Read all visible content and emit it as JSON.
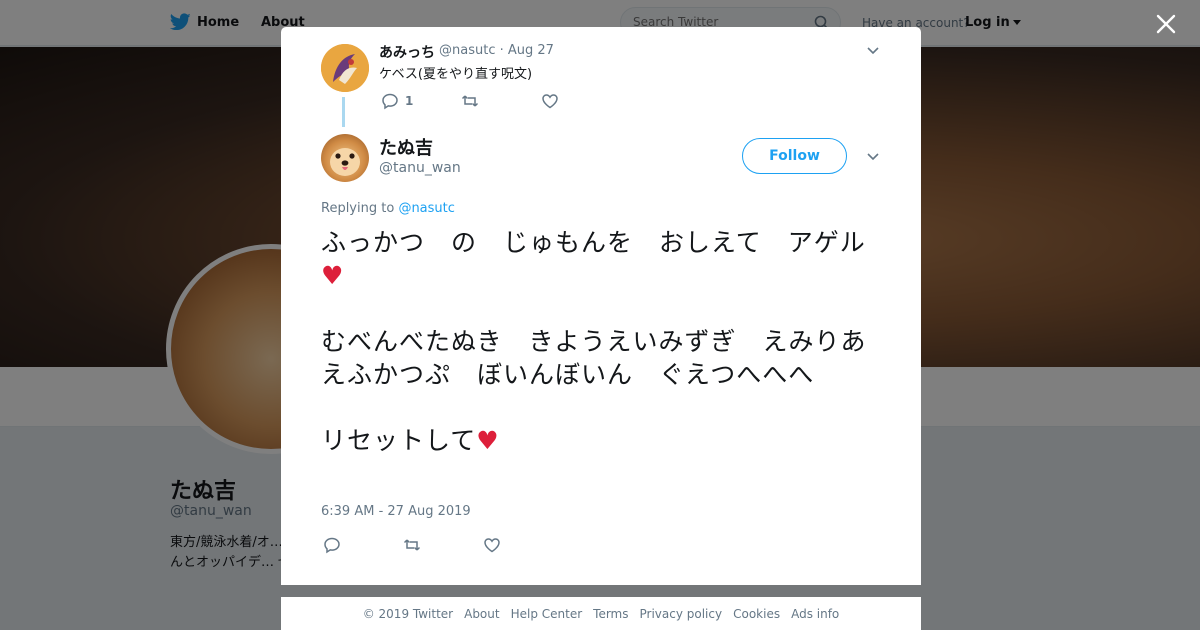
{
  "background": {
    "nav": {
      "home": "Home",
      "about": "About"
    },
    "search": {
      "placeholder": "Search Twitter"
    },
    "account_prompt": "Have an account?",
    "login": "Log in",
    "profile": {
      "name": "たぬ吉",
      "handle": "@tanu_wan",
      "bio": "東方/競泳水着/オ… ー何でもたまらね… ゃんとオッパイデ… ぜ。"
    }
  },
  "modal": {
    "parent_tweet": {
      "name": "あみっち",
      "handle": "@nasutc",
      "date": "Aug 27",
      "text": "ケベス(夏をやり直す呪文)",
      "reply_count": "1"
    },
    "main_tweet": {
      "name": "たぬ吉",
      "handle": "@tanu_wan",
      "follow_label": "Follow",
      "replying_prefix": "Replying to",
      "replying_handle": "@nasutc",
      "line1": "ふっかつ　の　じゅもんを　おしえて　アゲル",
      "line2": "むべんべたぬき　きようえいみずぎ　えみりあえふかつぷ　ぼいんぼいん　ぐえつへへへ",
      "line3": "リセットして",
      "heart": "♥",
      "timestamp": "6:39 AM - 27 Aug 2019"
    }
  },
  "footer": {
    "items": [
      "© 2019 Twitter",
      "About",
      "Help Center",
      "Terms",
      "Privacy policy",
      "Cookies",
      "Ads info"
    ]
  },
  "colors": {
    "accent": "#1da1f2",
    "heart": "#dd1f3a",
    "muted": "#657786"
  }
}
